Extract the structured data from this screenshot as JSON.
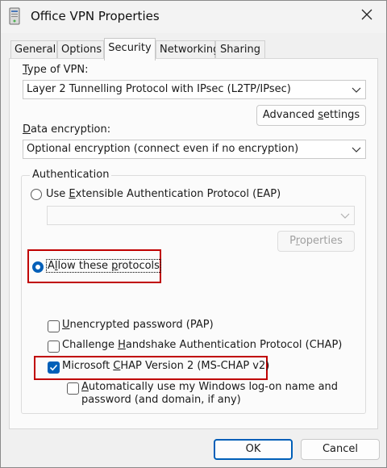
{
  "window": {
    "title": "Office VPN Properties",
    "icon": "vpn-server-icon",
    "close_icon": "close-icon"
  },
  "tabs": [
    {
      "label": "General",
      "active": false
    },
    {
      "label": "Options",
      "active": false
    },
    {
      "label": "Security",
      "active": true
    },
    {
      "label": "Networking",
      "active": false
    },
    {
      "label": "Sharing",
      "active": false
    }
  ],
  "security": {
    "vpn_type": {
      "label_pre": "",
      "label_key": "T",
      "label_post": "ype of VPN:",
      "value": "Layer 2 Tunnelling Protocol with IPsec (L2TP/IPsec)"
    },
    "advanced_settings": {
      "pre": "Advanced ",
      "key": "s",
      "post": "ettings"
    },
    "data_encryption": {
      "label_pre": "",
      "label_key": "D",
      "label_post": "ata encryption:",
      "value": "Optional encryption (connect even if no encryption)"
    },
    "authentication": {
      "group_title": "Authentication",
      "eap": {
        "pre": "Use ",
        "key": "E",
        "post": "xtensible Authentication Protocol (EAP)",
        "selected": false
      },
      "eap_dropdown_value": "",
      "properties": {
        "pre": "P",
        "key": "r",
        "post": "operties",
        "disabled": true
      },
      "allow": {
        "pre": "A",
        "key": "l",
        "mid": "low these ",
        "key2": "p",
        "post": "rotocols",
        "selected": true
      },
      "protocols": [
        {
          "pre": "",
          "key": "U",
          "post": "nencrypted password (PAP)",
          "checked": false
        },
        {
          "pre": "Challenge ",
          "key": "H",
          "post": "andshake Authentication Protocol (CHAP)",
          "checked": false
        },
        {
          "pre": "Microsoft ",
          "key": "C",
          "post": "HAP Version 2 (MS-CHAP v2)",
          "checked": true
        }
      ],
      "auto_logon": {
        "pre": "",
        "key": "A",
        "line1": "utomatically use my Windows log-on name and",
        "line2": "password (and domain, if any)",
        "checked": false
      }
    }
  },
  "footer": {
    "ok": "OK",
    "cancel": "Cancel"
  },
  "colors": {
    "accent": "#005fb8",
    "highlight": "#c00000"
  }
}
